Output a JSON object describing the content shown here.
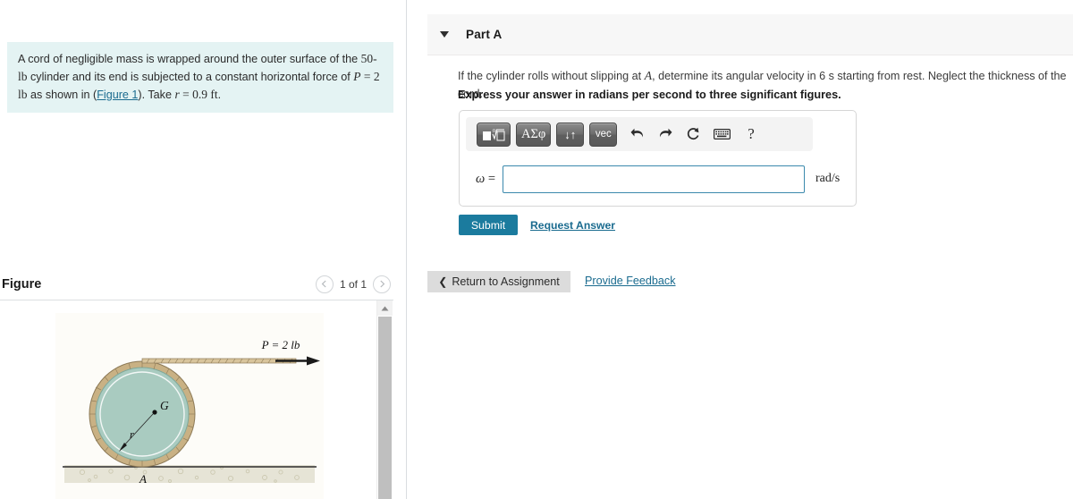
{
  "problem": {
    "text_1": "A cord of negligible mass is wrapped around the outer surface of the ",
    "mass": "50-lb",
    "text_2": " cylinder and its end is subjected to a constant horizontal force of ",
    "force_sym": "P",
    "force_eq": " = 2 lb",
    "text_3": " as shown in (",
    "figure_link": "Figure 1",
    "text_4": "). Take ",
    "radius_sym": "r",
    "radius_eq": " = 0.9 ft",
    "text_5": "."
  },
  "figure": {
    "title": "Figure",
    "prev_icon": "chevron-left-icon",
    "next_icon": "chevron-right-icon",
    "counter": "1 of 1",
    "diagram": {
      "force_label": "P = 2 lb",
      "center_label": "G",
      "radius_label": "r",
      "contact_label": "A",
      "cylinder_fill": "#a9cbc0",
      "cord_color": "#c9b184",
      "ground_color": "#d9d7c4"
    }
  },
  "part": {
    "collapse_icon": "caret-down-icon",
    "label": "Part A",
    "question_pre": "If the cylinder rolls without slipping at ",
    "question_point": "A",
    "question_post": ", determine its angular velocity in 6 s starting from rest. Neglect the thickness of the cord.",
    "instruction": "Express your answer in radians per second to three significant figures."
  },
  "answer": {
    "toolbar": {
      "template_btn": "template-icon",
      "greek_btn": "ΑΣφ",
      "updown_btn": "↓↑",
      "vec_btn": "vec",
      "undo_icon": "undo-icon",
      "redo_icon": "redo-icon",
      "reset_icon": "reset-icon",
      "keyboard_icon": "keyboard-icon",
      "help_icon": "?"
    },
    "variable": "ω",
    "equals": " =",
    "value": "",
    "placeholder": "",
    "units": "rad/s"
  },
  "actions": {
    "submit": "Submit",
    "request_answer": "Request Answer",
    "return_chevron": "❮",
    "return": "Return to Assignment",
    "feedback": "Provide Feedback"
  },
  "colors": {
    "accent": "#1b7b9e",
    "link": "#1a6b8f",
    "problem_bg": "#e4f3f3",
    "header_bg": "#f7f7f7",
    "input_border": "#3b89ad"
  }
}
